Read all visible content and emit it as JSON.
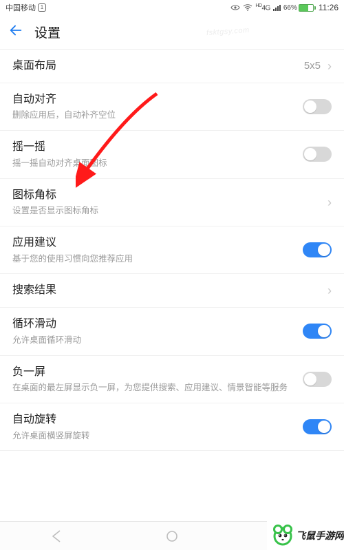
{
  "status": {
    "carrier": "中国移动",
    "sim_slot": "1",
    "network": "4G",
    "battery_pct": "66%",
    "time": "11:26"
  },
  "header": {
    "title": "设置"
  },
  "rows": {
    "layout": {
      "title": "桌面布局",
      "value": "5x5"
    },
    "autoalign": {
      "title": "自动对齐",
      "desc": "删除应用后，自动补齐空位",
      "on": false
    },
    "shake": {
      "title": "摇一摇",
      "desc": "摇一摇自动对齐桌面图标",
      "on": false
    },
    "badge": {
      "title": "图标角标",
      "desc": "设置是否显示图标角标"
    },
    "suggest": {
      "title": "应用建议",
      "desc": "基于您的使用习惯向您推荐应用",
      "on": true
    },
    "search": {
      "title": "搜索结果"
    },
    "loop": {
      "title": "循环滑动",
      "desc": "允许桌面循环滑动",
      "on": true
    },
    "minusone": {
      "title": "负一屏",
      "desc": "在桌面的最左屏显示负一屏，为您提供搜索、应用建议、情景智能等服务",
      "on": false
    },
    "autorotate": {
      "title": "自动旋转",
      "desc": "允许桌面横竖屏旋转",
      "on": true
    }
  },
  "watermark": "fsktgsy.com",
  "brand": "飞鼠手游网"
}
